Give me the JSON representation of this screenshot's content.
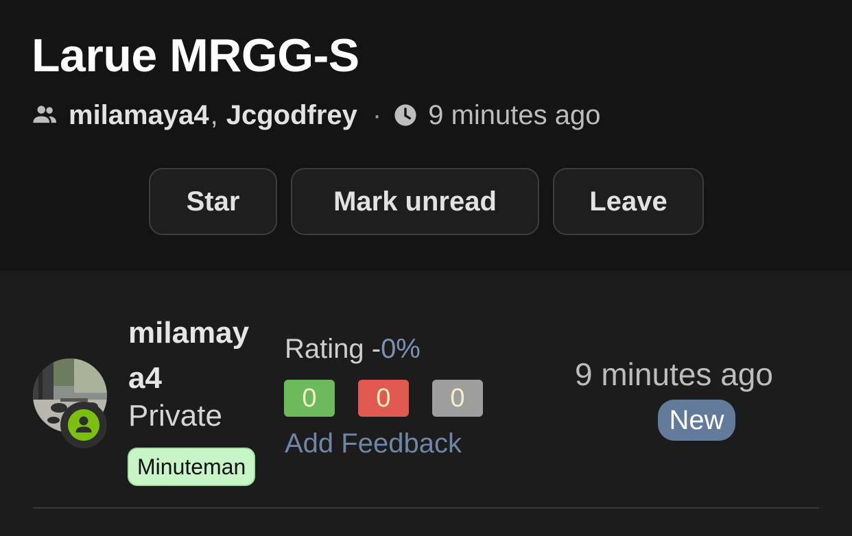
{
  "chat": {
    "title": "Larue MRGG-S",
    "participants": [
      "milamaya4",
      "Jcgodfrey"
    ],
    "participants_separator": ",",
    "meta_separator": "·",
    "updated": "9 minutes ago"
  },
  "actions": {
    "star_label": "Star",
    "mark_unread_label": "Mark unread",
    "leave_label": "Leave"
  },
  "member": {
    "username": "milamaya4",
    "rank": "Private",
    "tag": "Minuteman",
    "rating_label": "Rating -",
    "rating_percent": "0%",
    "feedback_counts": {
      "positive": "0",
      "negative": "0",
      "neutral": "0"
    },
    "add_feedback_label": "Add Feedback",
    "time": "9 minutes ago",
    "new_badge": "New"
  },
  "colors": {
    "background": "#1c1c1c",
    "header_background": "#141414",
    "positive": "#6dba5c",
    "negative": "#e05a4f",
    "neutral": "#9e9e9e",
    "link": "#6f86a6",
    "new_badge": "#627b9b",
    "tag_background": "#c7f5c7",
    "status_green": "#7cc00f"
  },
  "icons": {
    "participants": "people-icon",
    "time": "clock-icon",
    "status": "person-icon"
  }
}
